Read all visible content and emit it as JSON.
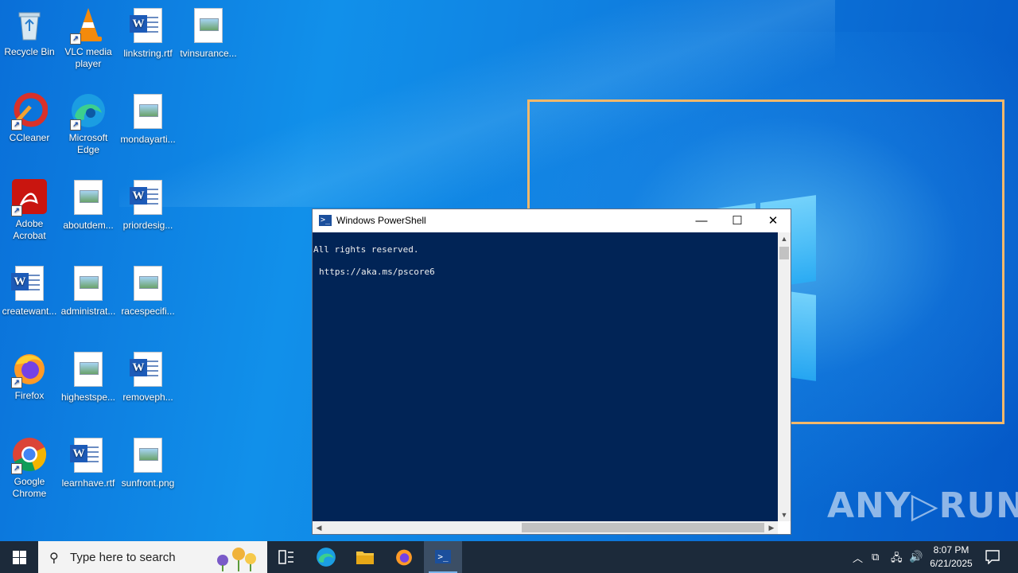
{
  "desktop": {
    "icons": [
      {
        "label": "Recycle Bin"
      },
      {
        "label": "VLC media player"
      },
      {
        "label": "linkstring.rtf"
      },
      {
        "label": "tvinsurance..."
      },
      {
        "label": "CCleaner"
      },
      {
        "label": "Microsoft Edge"
      },
      {
        "label": "mondayarti..."
      },
      {
        "label": "Adobe Acrobat"
      },
      {
        "label": "aboutdem..."
      },
      {
        "label": "priordesig..."
      },
      {
        "label": "createwant..."
      },
      {
        "label": "administrat..."
      },
      {
        "label": "racespecifi..."
      },
      {
        "label": "Firefox"
      },
      {
        "label": "highestspe..."
      },
      {
        "label": "removeph..."
      },
      {
        "label": "Google Chrome"
      },
      {
        "label": "learnhave.rtf"
      },
      {
        "label": "sunfront.png"
      }
    ],
    "watermark": "ANY▷RUN"
  },
  "powershell": {
    "title": "Windows PowerShell",
    "minimize": "—",
    "maximize": "☐",
    "close": "✕",
    "lines": [
      "All rights reserved.",
      "https://aka.ms/pscore6"
    ]
  },
  "taskbar": {
    "search_placeholder": "Type here to search",
    "time": "8:07 PM",
    "date": "6/21/2025"
  },
  "colors": {
    "console_bg": "#012456",
    "frame_highlight": "#f4b86a",
    "taskbar_bg": "#1c2a3a"
  }
}
